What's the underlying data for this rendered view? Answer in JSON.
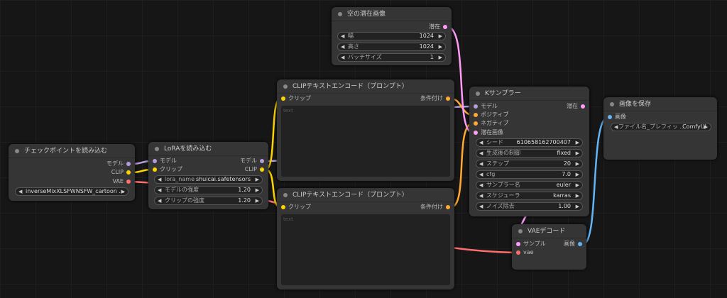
{
  "nodes": {
    "checkpoint": {
      "title": "チェックポイントを読み込む",
      "outputs": [
        "モデル",
        "CLIP",
        "VAE"
      ],
      "ckpt_name": "inverseMixXLSFWNSFW_cartoon ..."
    },
    "lora": {
      "title": "LoRAを読み込む",
      "inputs": [
        "モデル",
        "クリップ"
      ],
      "outputs": [
        "モデル",
        "CLIP"
      ],
      "lora_name_label": "lora_name",
      "lora_name": "shuicai.safetensors",
      "strength_model_label": "モデルの強度",
      "strength_model": "1.20",
      "strength_clip_label": "クリップの強度",
      "strength_clip": "1.20"
    },
    "latent": {
      "title": "空の潜在画像",
      "output": "潜在",
      "width_label": "幅",
      "width": "1024",
      "height_label": "高さ",
      "height": "1024",
      "batch_label": "バッチサイズ",
      "batch": "1"
    },
    "clip_pos": {
      "title": "CLIPテキストエンコード（プロンプト）",
      "input": "クリップ",
      "output": "条件付け",
      "placeholder": "text"
    },
    "clip_neg": {
      "title": "CLIPテキストエンコード（プロンプト）",
      "input": "クリップ",
      "output": "条件付け",
      "placeholder": "text"
    },
    "ksampler": {
      "title": "Kサンプラー",
      "inputs": [
        "モデル",
        "ポジティブ",
        "ネガティブ",
        "潜在画像"
      ],
      "output": "潜在",
      "widgets": [
        {
          "label": "シード",
          "value": "610658162700407"
        },
        {
          "label": "生成後の制御",
          "value": "fixed"
        },
        {
          "label": "ステップ",
          "value": "20"
        },
        {
          "label": "cfg",
          "value": "7.0"
        },
        {
          "label": "サンプラー名",
          "value": "euler"
        },
        {
          "label": "スケジューラ",
          "value": "karras"
        },
        {
          "label": "ノイズ除去",
          "value": "1.00"
        }
      ]
    },
    "save": {
      "title": "画像を保存",
      "input": "画像",
      "prefix_label": "ファイル名_プレフィッ ...",
      "prefix": "ComfyUI"
    },
    "vae_decode": {
      "title": "VAEデコード",
      "inputs": [
        "サンプル",
        "vae"
      ],
      "output": "画像"
    }
  },
  "colors": {
    "model": "#b39ddb",
    "clip": "#ffd500",
    "vae": "#ff6e6e",
    "latent": "#ff9cf9",
    "conditioning": "#ffa931",
    "image": "#64b5f6"
  }
}
